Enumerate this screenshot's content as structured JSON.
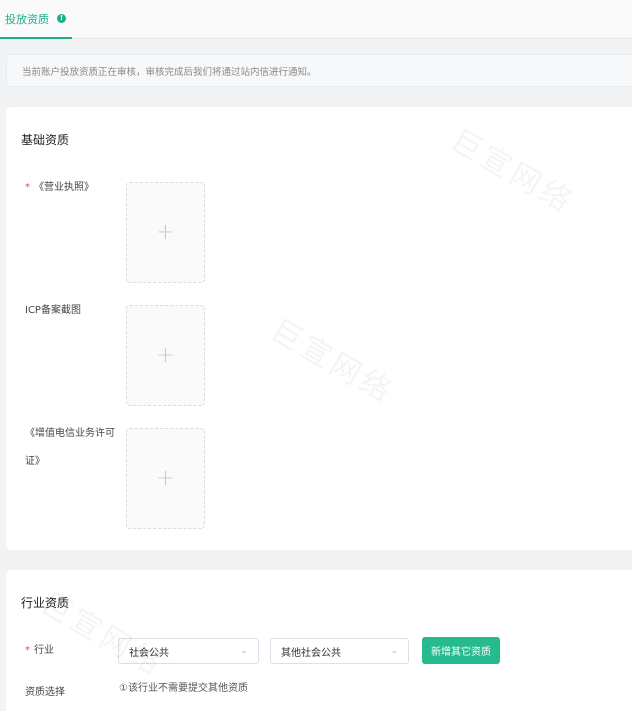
{
  "tabs": {
    "active_label": "投放资质",
    "info_icon": "info-icon"
  },
  "notice": {
    "text": "当前账户投放资质正在审核，审核完成后我们将通过站内信进行通知。"
  },
  "basic": {
    "title": "基础资质",
    "required_mark": "*",
    "fields": [
      {
        "label": "《营业执照》",
        "required": true
      },
      {
        "label": "ICP备案截图",
        "required": false
      },
      {
        "label_line1": "《增值电信业务许可",
        "label_line2": "证》",
        "required": false
      }
    ],
    "upload_glyph": "+"
  },
  "industry": {
    "title": "行业资质",
    "required_mark": "*",
    "industry_label": "行业",
    "select1_value": "社会公共",
    "select2_value": "其他社会公共",
    "add_button": "新增其它资质",
    "select_label": "资质选择",
    "tip": "①该行业不需要提交其他资质"
  },
  "watermark": {
    "text": "巨宣网络"
  },
  "colors": {
    "accent": "#1fae8a",
    "button": "#27ba8e",
    "required": "#e5484d"
  }
}
